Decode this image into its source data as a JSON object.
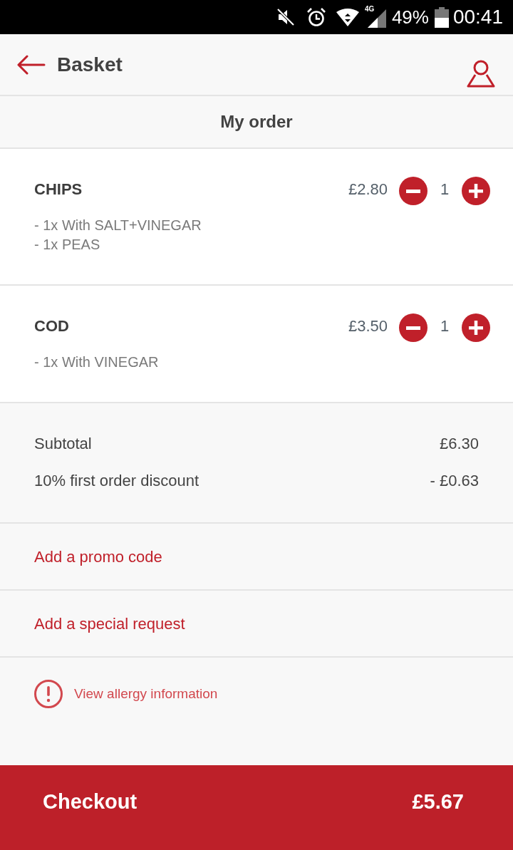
{
  "status_bar": {
    "network": "4G",
    "battery": "49%",
    "time": "00:41"
  },
  "header": {
    "title": "Basket"
  },
  "section_title": "My order",
  "items": [
    {
      "name": "CHIPS",
      "price": "£2.80",
      "quantity": "1",
      "options": [
        "- 1x With SALT+VINEGAR",
        "- 1x PEAS"
      ]
    },
    {
      "name": "COD",
      "price": "£3.50",
      "quantity": "1",
      "options": [
        "- 1x With VINEGAR"
      ]
    }
  ],
  "summary": [
    {
      "label": "Subtotal",
      "value": "£6.30"
    },
    {
      "label": "10% first order discount",
      "value": "- £0.63"
    }
  ],
  "links": [
    "Add a promo code",
    "Add a special request"
  ],
  "allergy": {
    "label": "View allergy information"
  },
  "checkout": {
    "label": "Checkout",
    "total": "£5.67"
  }
}
